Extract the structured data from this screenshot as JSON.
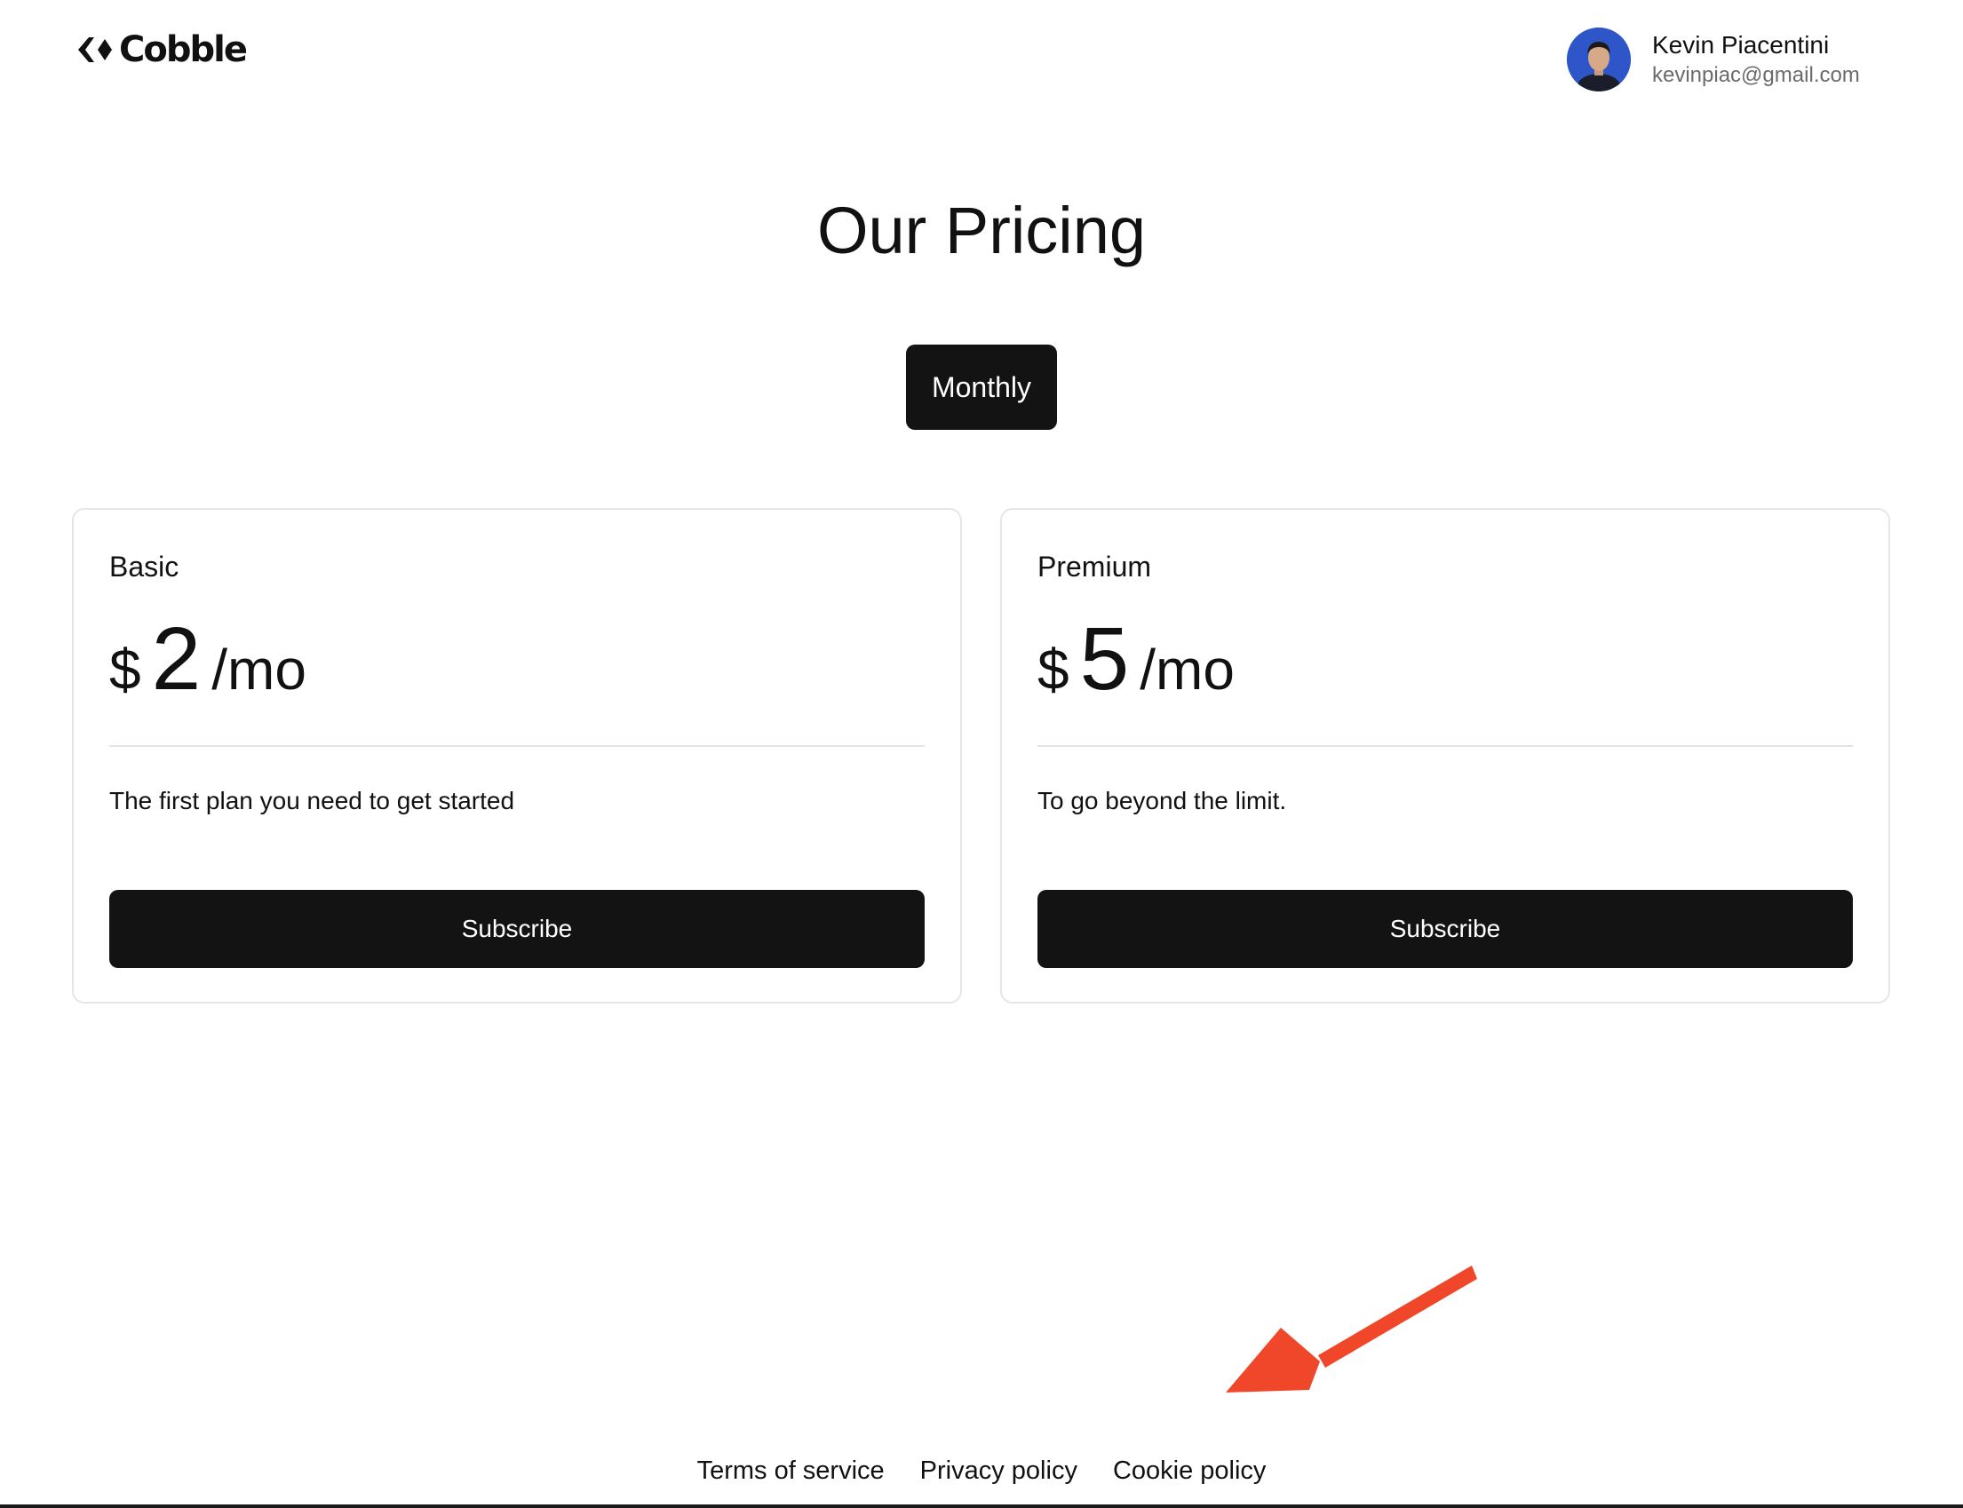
{
  "header": {
    "logo_icon": "cobble-diamond-logo",
    "logo_text": "Cobble",
    "user": {
      "name": "Kevin Piacentini",
      "email": "kevinpiac@gmail.com"
    }
  },
  "main": {
    "title": "Our Pricing",
    "period_toggle_label": "Monthly",
    "plans": [
      {
        "name": "Basic",
        "currency": "$",
        "amount": "2",
        "period": "/mo",
        "description": "The first plan you need to get started",
        "cta_label": "Subscribe"
      },
      {
        "name": "Premium",
        "currency": "$",
        "amount": "5",
        "period": "/mo",
        "description": "To go beyond the limit.",
        "cta_label": "Subscribe"
      }
    ]
  },
  "annotation": {
    "icon": "arrow-annotation-icon",
    "color": "#f0472a"
  },
  "footer": {
    "links": [
      "Terms of service",
      "Privacy policy",
      "Cookie policy"
    ]
  },
  "colors": {
    "primary_button": "#131313",
    "card_border": "#e6e6e6",
    "text": "#111111",
    "muted_text": "#6b6b6b"
  }
}
